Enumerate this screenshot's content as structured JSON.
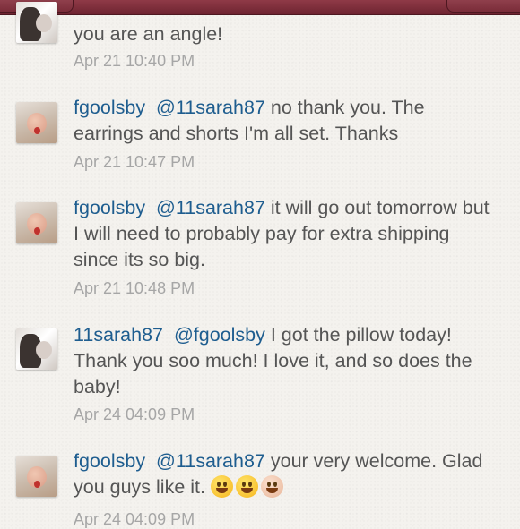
{
  "comments": [
    {
      "user": "",
      "mention": "",
      "text": "you are an angle!",
      "time": "Apr 21 10:40 PM"
    },
    {
      "user": "fgoolsby",
      "mention": "@11sarah87",
      "text": " no thank you. The earrings and shorts I'm all set. Thanks",
      "time": "Apr 21 10:47 PM"
    },
    {
      "user": "fgoolsby",
      "mention": "@11sarah87",
      "text": " it will go out tomorrow but I will need to probably pay for extra shipping since its so big.",
      "time": "Apr 21 10:48 PM"
    },
    {
      "user": "11sarah87",
      "mention": "@fgoolsby",
      "text": " I got the pillow today! Thank you soo much! I love it, and so does the baby!",
      "time": "Apr 24 04:09 PM"
    },
    {
      "user": "fgoolsby",
      "mention": "@11sarah87",
      "text": " your very welcome. Glad you guys like it. ",
      "time": "Apr 24 04:09 PM"
    }
  ],
  "emojis": [
    "grinning-face-icon",
    "smiling-face-icon",
    "baby-face-icon"
  ]
}
